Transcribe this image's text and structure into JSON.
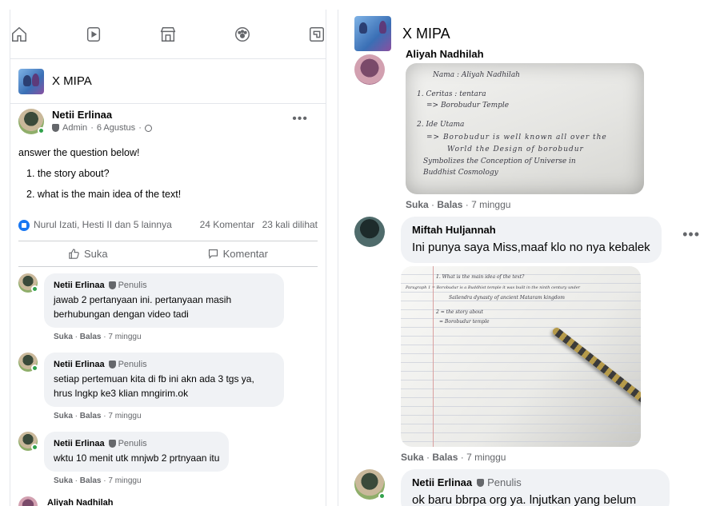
{
  "left": {
    "nav": [
      "home-icon",
      "watch-icon",
      "marketplace-icon",
      "groups-icon",
      "gaming-icon"
    ],
    "group_name": "X MIPA",
    "post": {
      "author": "Netii Erlinaa",
      "role": "Admin",
      "date": "6 Agustus",
      "text": "answer the question below!",
      "q1": "1. the story about?",
      "q2": "2. what is the main idea of the text!",
      "reactors": "Nurul Izati, Hesti II dan 5 lainnya",
      "comments_count": "24 Komentar",
      "views": "23 kali dilihat",
      "like_label": "Suka",
      "comment_label": "Komentar"
    },
    "comments": [
      {
        "author": "Netii Erlinaa",
        "badge": "Penulis",
        "text": "jawab 2 pertanyaan ini. pertanyaan masih berhubungan dengan video tadi",
        "like": "Suka",
        "reply": "Balas",
        "time": "7 minggu"
      },
      {
        "author": "Netii Erlinaa",
        "badge": "Penulis",
        "text": "setiap pertemuan kita di fb ini akn ada 3 tgs ya, hrus lngkp ke3 klian mngirim.ok",
        "like": "Suka",
        "reply": "Balas",
        "time": "7 minggu"
      },
      {
        "author": "Netii Erlinaa",
        "badge": "Penulis",
        "text": "wktu 10 menit utk mnjwb 2 prtnyaan itu",
        "like": "Suka",
        "reply": "Balas",
        "time": "7 minggu"
      },
      {
        "author": "Aliyah Nadhilah"
      }
    ]
  },
  "right": {
    "group_name": "X MIPA",
    "c1": {
      "author": "Aliyah Nadhilah",
      "like": "Suka",
      "reply": "Balas",
      "time": "7 minggu"
    },
    "photo1_lines": [
      "Nama : Aliyah Nadhilah",
      "1. Ceritas : tentara",
      "=> Borobudur Temple",
      "2. Ide Utama",
      "=> Borobudur is well known all over the",
      "World the Design of borobudur",
      "Symbolizes the Conception of Universe in",
      "Buddhist Cosmology"
    ],
    "c2": {
      "author": "Miftah Huljannah",
      "text": "Ini punya saya Miss,maaf klo no nya kebalek",
      "like": "Suka",
      "reply": "Balas",
      "time": "7 minggu"
    },
    "photo2_lines": [
      "1. What is the main idea of the text?",
      "Paragraph 1 = Borobudur is a Buddhist temple it was built in the ninth century under",
      "Sailendra dynasty of ancient Mataram kingdom",
      "2 = the story about",
      "= Borobudur temple"
    ],
    "c3": {
      "author": "Netii Erlinaa",
      "badge": "Penulis",
      "text": "ok baru bbrpa org ya. lnjutkan yang belum"
    }
  }
}
